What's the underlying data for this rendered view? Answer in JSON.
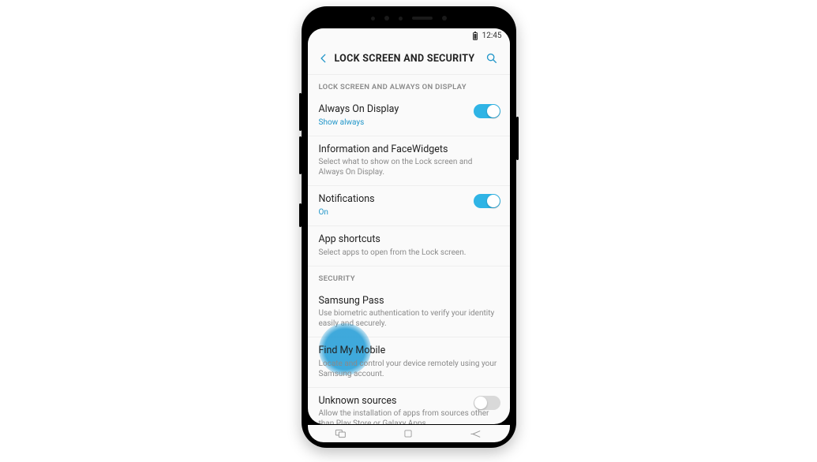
{
  "status": {
    "time": "12:45"
  },
  "header": {
    "title": "LOCK SCREEN AND SECURITY"
  },
  "sections": {
    "s1": {
      "label": "LOCK SCREEN AND ALWAYS ON DISPLAY"
    },
    "s2": {
      "label": "SECURITY"
    }
  },
  "rows": {
    "aod": {
      "title": "Always On Display",
      "sub": "Show always"
    },
    "info": {
      "title": "Information and FaceWidgets",
      "sub": "Select what to show on the Lock screen and Always On Display."
    },
    "notif": {
      "title": "Notifications",
      "sub": "On"
    },
    "shortcuts": {
      "title": "App shortcuts",
      "sub": "Select apps to open from the Lock screen."
    },
    "spass": {
      "title": "Samsung Pass",
      "sub": "Use biometric authentication to verify your identity easily and securely."
    },
    "findmobile": {
      "title": "Find My Mobile",
      "sub": "Locate and control your device remotely using your Samsung account."
    },
    "unknown": {
      "title": "Unknown sources",
      "sub": "Allow the installation of apps from sources other than Play Store or Galaxy Apps."
    }
  }
}
